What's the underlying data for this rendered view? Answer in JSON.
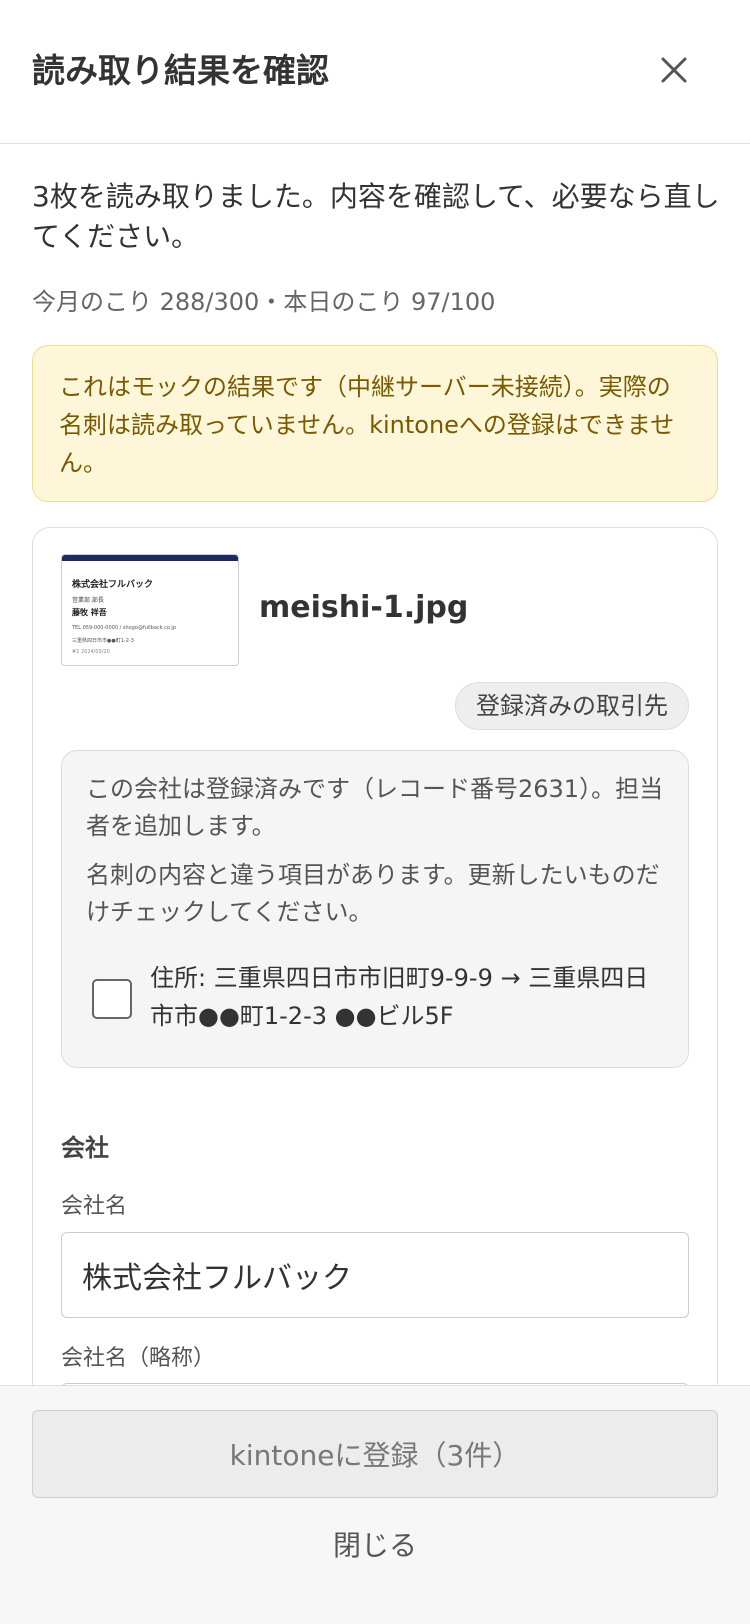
{
  "header": {
    "title": "読み取り結果を確認",
    "close_icon": "close-icon"
  },
  "intro_text": "3枚を読み取りました。内容を確認して、必要なら直してください。",
  "quota_text": "今月のこり 288/300・本日のこり 97/100",
  "notice_text": "これはモックの結果です（中継サーバー未接続）。実際の名刺は読み取っていません。kintoneへの登録はできません。",
  "card": {
    "thumbnail": {
      "company": "株式会社フルバック",
      "dept": "営業部 部長",
      "name": "藤牧 祥吾",
      "contact": "TEL 059-000-0000 / shogo@fullback.co.jp",
      "address": "三重県四日市市●●町1-2-3",
      "extra": "#1 2024/03/20"
    },
    "filename": "meishi-1.jpg",
    "badge": "登録済みの取引先",
    "duplicate": {
      "message1": "この会社は登録済みです（レコード番号2631）。担当者を追加します。",
      "message2": "名刺の内容と違う項目があります。更新したいものだけチェックしてください。",
      "diff_label": "住所: 三重県四日市市旧町9-9-9 → 三重県四日市市●●町1-2-3 ●●ビル5F",
      "diff_checked": false
    },
    "section_title": "会社",
    "fields": [
      {
        "label": "会社名",
        "value": "株式会社フルバック"
      },
      {
        "label": "会社名（略称）",
        "value": ""
      }
    ]
  },
  "footer": {
    "register_label": "kintoneに登録（3件）",
    "close_label": "閉じる"
  },
  "colors": {
    "notice_bg": "#fdf6d8",
    "notice_text": "#7a5a00",
    "thumb_bar": "#1e2a5e"
  }
}
